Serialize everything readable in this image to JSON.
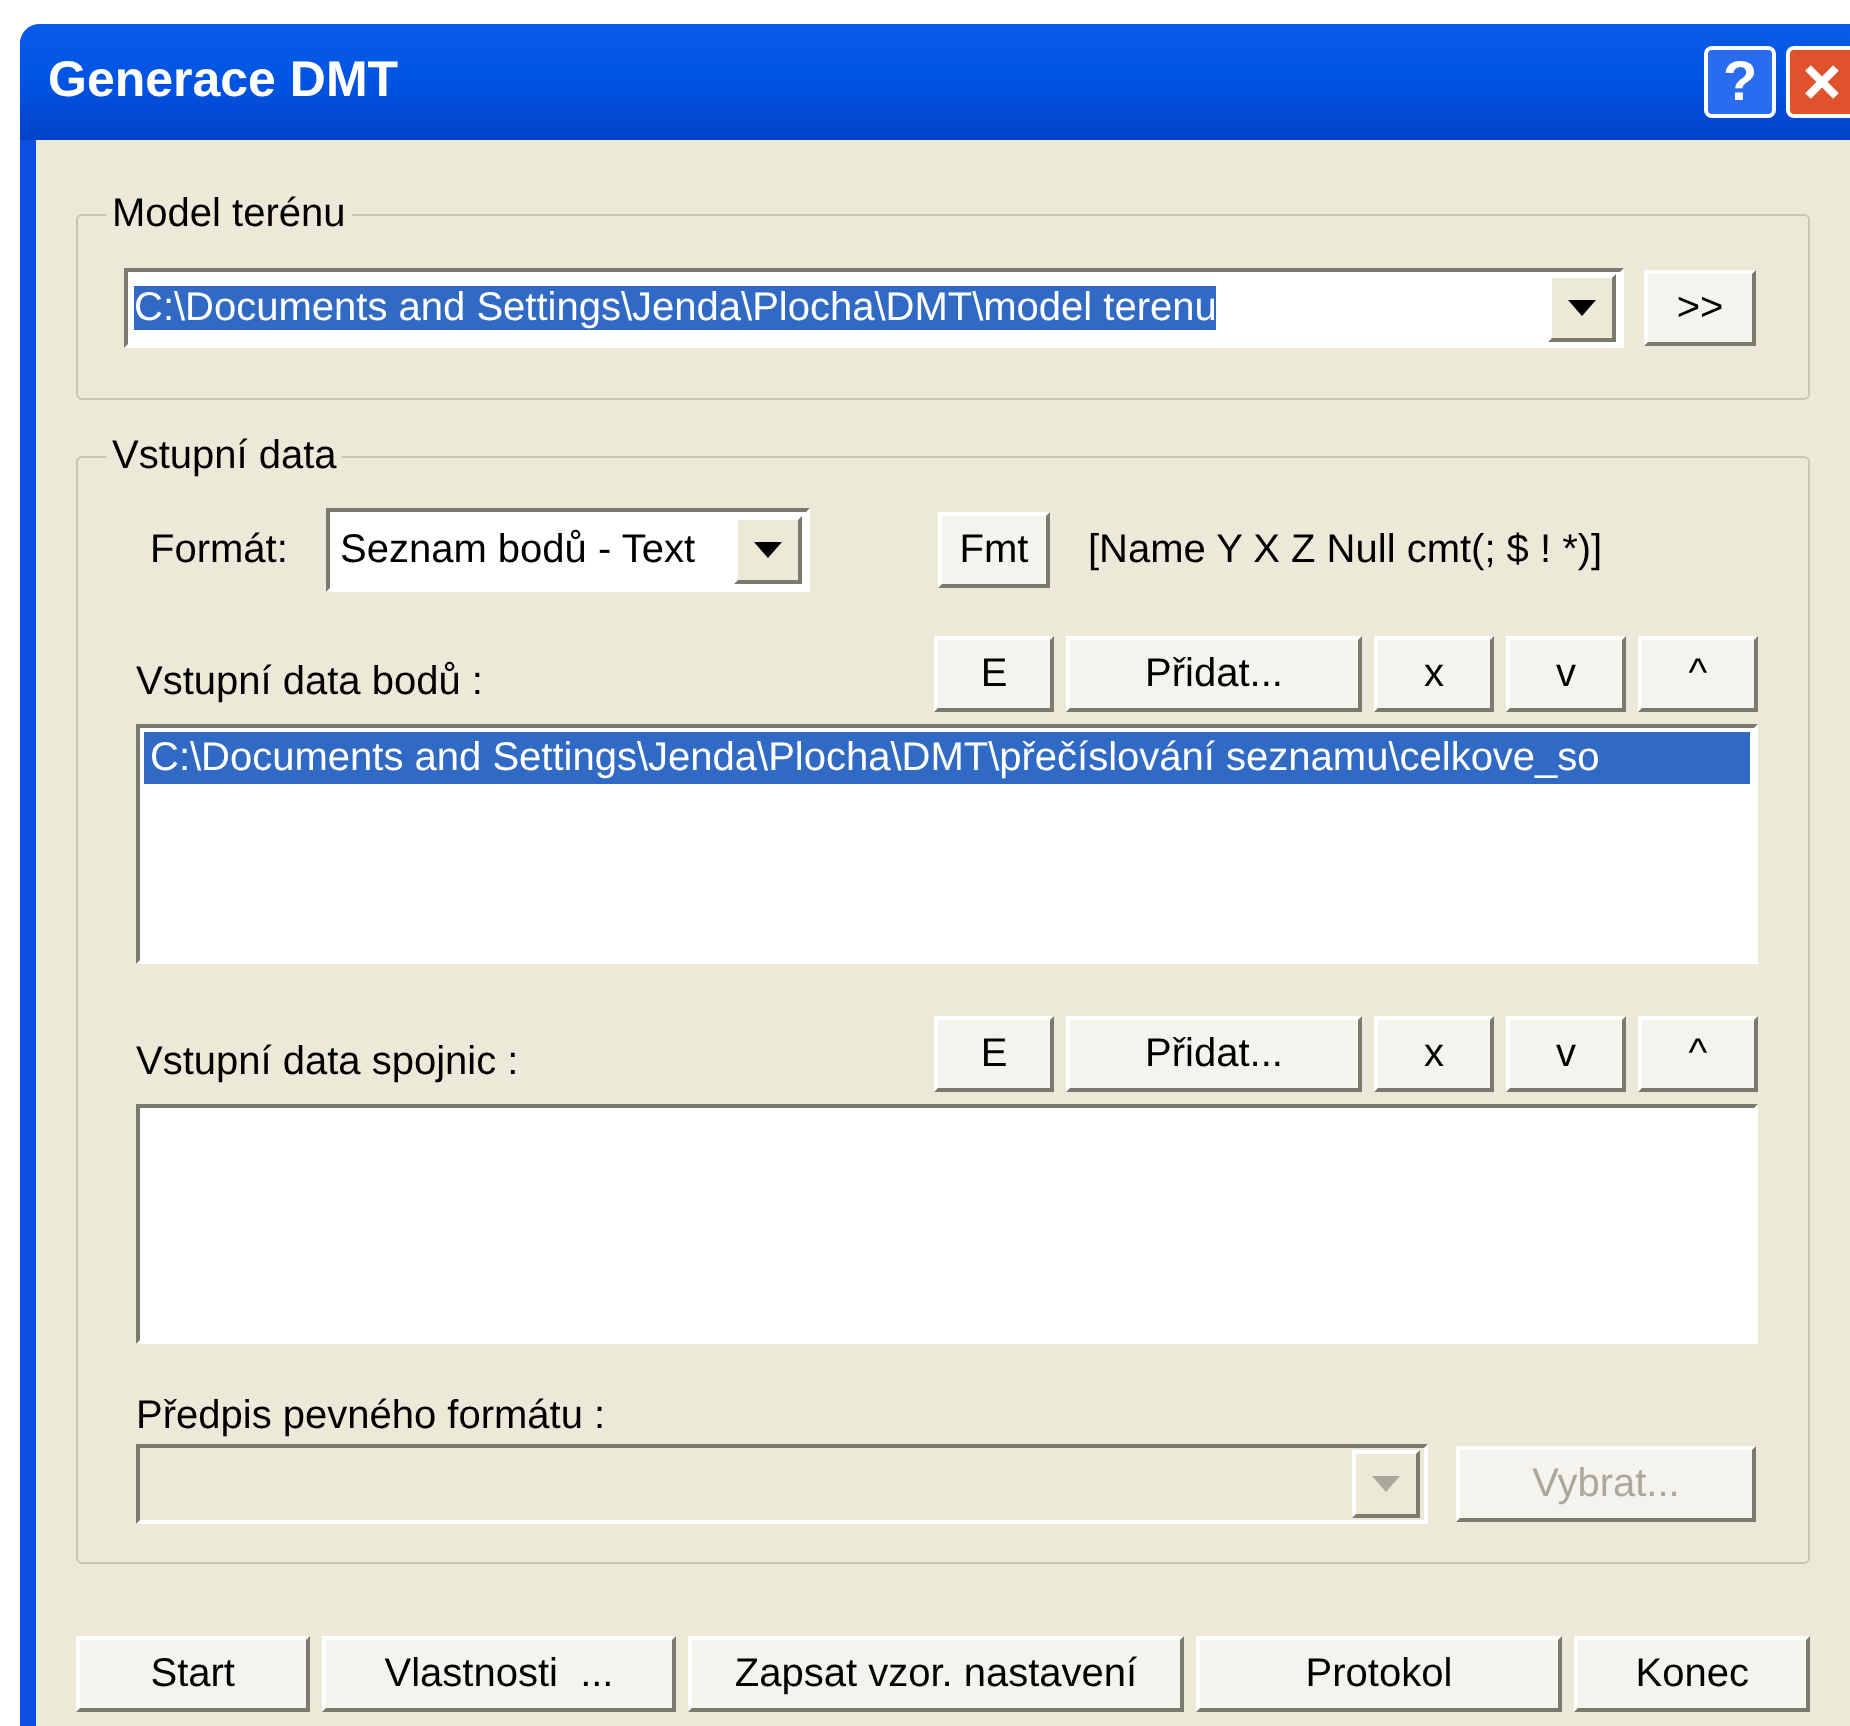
{
  "window": {
    "title": "Generace DMT",
    "help_button": "?"
  },
  "model_group": {
    "title": "Model terénu",
    "combo": {
      "value": "C:\\Documents and Settings\\Jenda\\Plocha\\DMT\\model terenu",
      "text_selected": true
    },
    "browse_button": ">>"
  },
  "input_group": {
    "title": "Vstupní data",
    "format": {
      "label": "Formát:",
      "value": "Seznam bodů - Text",
      "button": "Fmt",
      "hint": "[Name Y X Z Null cmt(; $ ! *)]"
    },
    "lists": [
      {
        "label": "Vstupní data bodů :",
        "buttons": [
          "E",
          "Přidat...",
          "x",
          "v",
          "^"
        ],
        "items": [
          {
            "text": "C:\\Documents and Settings\\Jenda\\Plocha\\DMT\\přečíslování seznamu\\celkove_so",
            "selected": true
          }
        ]
      },
      {
        "label": "Vstupní data spojnic :",
        "buttons": [
          "E",
          "Přidat...",
          "x",
          "v",
          "^"
        ]
      }
    ],
    "fixed_format": {
      "label": "Předpis pevného formátu :",
      "disabled": true,
      "button": "Vybrat..."
    }
  },
  "footer_buttons": [
    "Start",
    "Vlastnosti  ...",
    "Zapsat vzor. nastavení",
    "Protokol",
    "Konec"
  ]
}
